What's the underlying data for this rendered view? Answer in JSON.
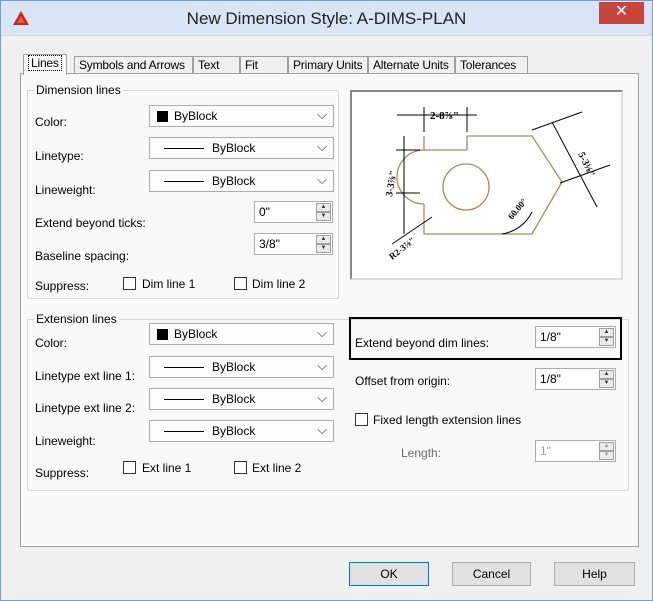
{
  "window": {
    "title": "New Dimension Style: A-DIMS-PLAN",
    "close_glyph": "✕"
  },
  "tabs": [
    {
      "label": "Lines"
    },
    {
      "label": "Symbols and Arrows"
    },
    {
      "label": "Text"
    },
    {
      "label": "Fit"
    },
    {
      "label": "Primary Units"
    },
    {
      "label": "Alternate Units"
    },
    {
      "label": "Tolerances"
    }
  ],
  "dimension_lines": {
    "legend": "Dimension lines",
    "color_label": "Color:",
    "color_value": "ByBlock",
    "linetype_label": "Linetype:",
    "linetype_value": "ByBlock",
    "lineweight_label": "Lineweight:",
    "lineweight_value": "ByBlock",
    "extend_label": "Extend beyond ticks:",
    "extend_value": "0\"",
    "baseline_label": "Baseline spacing:",
    "baseline_value": "3/8\"",
    "suppress_label": "Suppress:",
    "dim1_label": "Dim line 1",
    "dim2_label": "Dim line 2"
  },
  "extension_lines": {
    "legend": "Extension lines",
    "color_label": "Color:",
    "color_value": "ByBlock",
    "lt1_label": "Linetype ext line 1:",
    "lt1_value": "ByBlock",
    "lt2_label": "Linetype ext line 2:",
    "lt2_value": "ByBlock",
    "lineweight_label": "Lineweight:",
    "lineweight_value": "ByBlock",
    "suppress_label": "Suppress:",
    "ext1_label": "Ext line 1",
    "ext2_label": "Ext line 2",
    "extend_label": "Extend beyond dim lines:",
    "extend_value": "1/8\"",
    "offset_label": "Offset from origin:",
    "offset_value": "1/8\"",
    "fixed_label": "Fixed length extension lines",
    "length_label": "Length:",
    "length_value": "1\""
  },
  "preview": {
    "dim_top": "2-8⅞\"",
    "dim_left": "3-3⅞\"",
    "dim_right": "5-3⅛\"",
    "dim_angle": "60.00°",
    "dim_radius": "R2-3⅞\""
  },
  "buttons": {
    "ok": "OK",
    "cancel": "Cancel",
    "help": "Help"
  },
  "colors": {
    "swatch": "#000000",
    "title_bg": "#d9e5f4",
    "close_bg": "#c7453a",
    "preview_shape": "#b08850"
  },
  "icons": {
    "app": "autocad-logo-icon",
    "dropdown": "chevron-down-icon"
  }
}
